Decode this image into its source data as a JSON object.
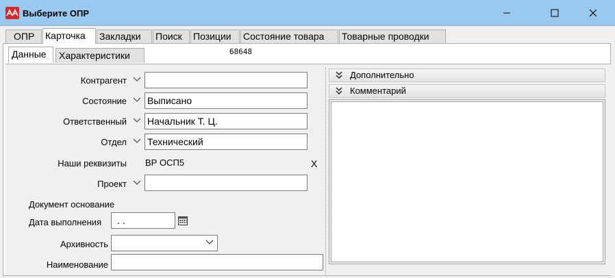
{
  "window": {
    "title": "Выберите ОПР",
    "minimize_icon": "minimize-icon",
    "maximize_icon": "maximize-icon",
    "close_icon": "close-icon"
  },
  "tabs": [
    {
      "label": "ОПР"
    },
    {
      "label": "Карточка",
      "active": true
    },
    {
      "label": "Закладки"
    },
    {
      "label": "Поиск"
    },
    {
      "label": "Позиции"
    },
    {
      "label": "Состояние товара"
    },
    {
      "label": "Товарные проводки"
    }
  ],
  "subtabs": [
    {
      "label": "Данные",
      "active": true
    },
    {
      "label": "Характеристики"
    }
  ],
  "record_id": "68648",
  "form": {
    "kontragent": {
      "label": "Контрагент",
      "value": ""
    },
    "sostoyanie": {
      "label": "Состояние",
      "value": "Выписано"
    },
    "otvetstvenny": {
      "label": "Ответственный",
      "value": "Начальник Т. Ц."
    },
    "otdel": {
      "label": "Отдел",
      "value": "Технический"
    },
    "rekvizity": {
      "label": "Наши реквизиты",
      "value": "ВР ОСП5",
      "clear_label": "X"
    },
    "proekt": {
      "label": "Проект",
      "value": ""
    },
    "doc_osnovanie": {
      "label": "Документ основание"
    },
    "data_vypolneniya": {
      "label": "Дата выполнения",
      "value": " .  ."
    },
    "arhivnost": {
      "label": "Архивность",
      "value": ""
    },
    "naimenovanie": {
      "label": "Наименование",
      "value": ""
    }
  },
  "right_panel": {
    "dopolnitelno": "Дополнительно",
    "kommentariy": "Комментарий"
  }
}
